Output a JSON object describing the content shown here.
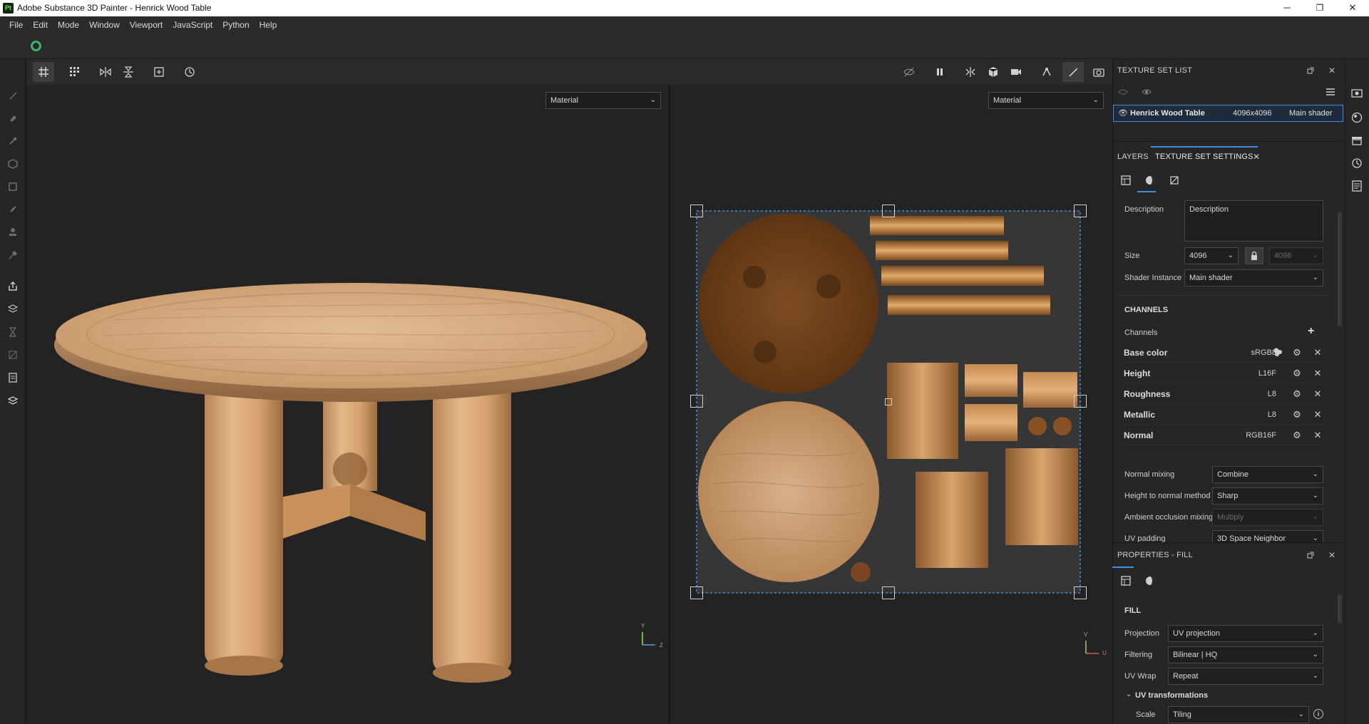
{
  "window": {
    "logo_text": "Pt",
    "title": "Adobe Substance 3D Painter - Henrick Wood Table",
    "minimize": "─",
    "maximize": "❐",
    "close": "✕"
  },
  "menubar": [
    "File",
    "Edit",
    "Mode",
    "Window",
    "Viewport",
    "JavaScript",
    "Python",
    "Help"
  ],
  "viewports": {
    "left_mode": "Material",
    "right_mode": "Material",
    "left_axes": {
      "y": "Y",
      "z": "Z"
    },
    "right_axes": {
      "v": "V",
      "u": "U"
    }
  },
  "texture_set_list": {
    "title": "TEXTURE SET LIST",
    "item": {
      "name": "Henrick Wood Table",
      "size": "4096x4096",
      "shader": "Main shader"
    }
  },
  "tabs": {
    "layers": "LAYERS",
    "texture_set_settings": "TEXTURE SET SETTINGS",
    "close": "✕"
  },
  "texture_set_settings": {
    "description_label": "Description",
    "description_value": "Description",
    "size_label": "Size",
    "size_value": "4096",
    "size_value_locked": "4096",
    "shader_instance_label": "Shader Instance",
    "shader_instance_value": "Main shader",
    "channels_header": "CHANNELS",
    "channels_label": "Channels",
    "channels": [
      {
        "name": "Base color",
        "format": "sRGB8"
      },
      {
        "name": "Height",
        "format": "L16F"
      },
      {
        "name": "Roughness",
        "format": "L8"
      },
      {
        "name": "Metallic",
        "format": "L8"
      },
      {
        "name": "Normal",
        "format": "RGB16F"
      }
    ],
    "normal_mixing_label": "Normal mixing",
    "normal_mixing_value": "Combine",
    "height_to_normal_label": "Height to normal method",
    "height_to_normal_value": "Sharp",
    "ao_mixing_label": "Ambient occlusion mixing",
    "ao_mixing_value": "Multiply",
    "uv_padding_label": "UV padding",
    "uv_padding_value": "3D Space Neighbor"
  },
  "properties_fill": {
    "title": "PROPERTIES - FILL",
    "fill_header": "FILL",
    "projection_label": "Projection",
    "projection_value": "UV projection",
    "filtering_label": "Filtering",
    "filtering_value": "Bilinear | HQ",
    "uv_wrap_label": "UV Wrap",
    "uv_wrap_value": "Repeat",
    "uv_transformations_label": "UV transformations",
    "scale_label": "Scale",
    "scale_value": "Tiling"
  },
  "colors": {
    "accent_blue": "#3c8ee6",
    "status_green": "#3fb36a",
    "wood_light": "#d9ab78",
    "wood_dark": "#7a4a22"
  }
}
